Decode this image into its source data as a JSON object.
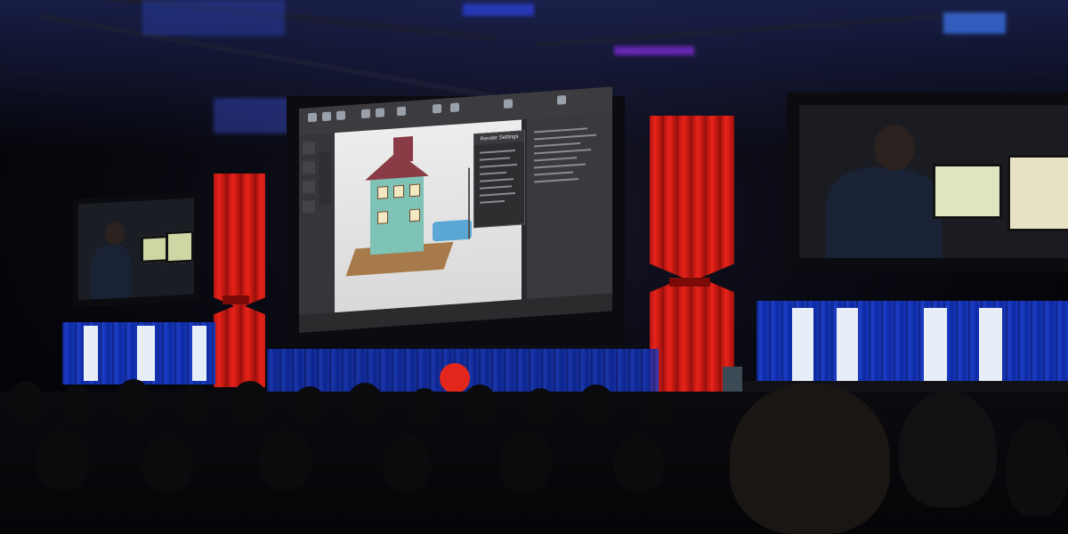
{
  "scene": {
    "description_tags": [
      "conference-hall",
      "stage",
      "projection-screens",
      "audience"
    ],
    "colors": {
      "curtain_red": "#e8231a",
      "led_blue": "#1d3fc9",
      "ceiling_blue": "#2b3fd1",
      "brand_red": "#e3261c",
      "house_teal": "#7fc2b6",
      "roof_maroon": "#8a3b45"
    }
  },
  "main_screen": {
    "dialog_title": "Render Settings"
  },
  "icons": {
    "stage_logo": "brand-logo-icon",
    "led_symbol": "ring-logo-icon"
  }
}
